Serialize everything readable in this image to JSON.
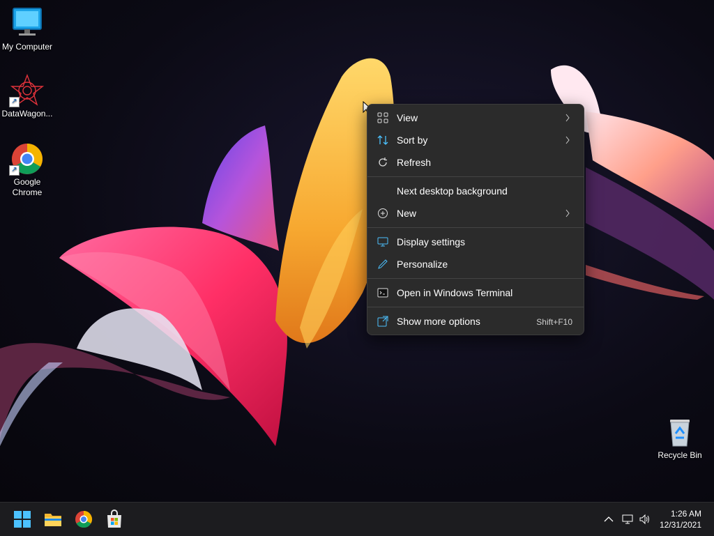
{
  "desktop": {
    "icons": [
      {
        "label": "My Computer",
        "icon": "monitor-icon"
      },
      {
        "label": "DataWagon...",
        "icon": "datawagon-logo-icon"
      },
      {
        "label": "Google Chrome",
        "icon": "chrome-icon"
      },
      {
        "label": "Recycle Bin",
        "icon": "recycle-bin-icon"
      }
    ]
  },
  "context_menu": {
    "items": [
      {
        "label": "View",
        "icon": "grid-icon",
        "submenu": true
      },
      {
        "label": "Sort by",
        "icon": "sort-icon",
        "submenu": true
      },
      {
        "label": "Refresh",
        "icon": "refresh-icon"
      },
      {
        "label": "Next desktop background",
        "icon": ""
      },
      {
        "label": "New",
        "icon": "plus-circle-icon",
        "submenu": true
      },
      {
        "label": "Display settings",
        "icon": "display-icon"
      },
      {
        "label": "Personalize",
        "icon": "pen-icon"
      },
      {
        "label": "Open in Windows Terminal",
        "icon": "terminal-icon"
      },
      {
        "label": "Show more options",
        "icon": "external-icon",
        "accelerator": "Shift+F10"
      }
    ]
  },
  "taskbar": {
    "apps": [
      "windows-start-icon",
      "file-explorer-icon",
      "chrome-icon",
      "store-icon"
    ],
    "tray": [
      "chevron-up-icon",
      "network-icon",
      "volume-icon"
    ],
    "time": "1:26 AM",
    "date": "12/31/2021"
  },
  "colors": {
    "menu_bg": "#2b2b2b",
    "taskbar_bg": "#1c1c1f",
    "accent": "#4cc2ff"
  }
}
